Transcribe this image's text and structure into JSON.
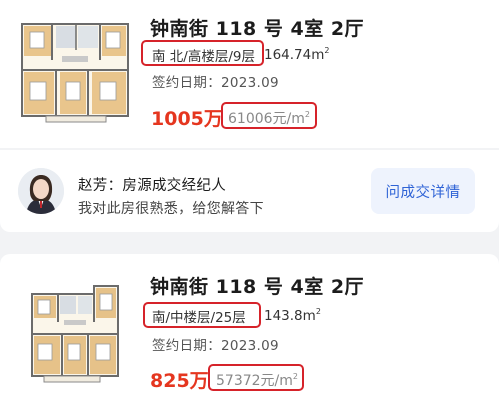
{
  "listings": [
    {
      "title": "钟南街 118 号 4室 2厅",
      "orientation_floor": "南 北/高楼层/9层",
      "area": "164.74m",
      "area_sup": "2",
      "sign_date": "签约日期：2023.09",
      "total_price": "1005万",
      "unit_price": "61006元/m",
      "unit_price_sup": "2"
    },
    {
      "title": "钟南街 118 号 4室 2厅",
      "orientation_floor": "南/中楼层/25层",
      "area": "143.8m",
      "area_sup": "2",
      "sign_date": "签约日期：2023.09",
      "total_price": "825万",
      "unit_price": "57372元/m",
      "unit_price_sup": "2"
    }
  ],
  "agent": {
    "name_role": "赵芳：房源成交经纪人",
    "message": "我对此房很熟悉，给您解答下",
    "button_label": "问成交详情"
  },
  "colors": {
    "price": "#e5361f",
    "highlight": "#d6232a",
    "button_text": "#2f63d6",
    "button_bg": "#eef3fd"
  }
}
